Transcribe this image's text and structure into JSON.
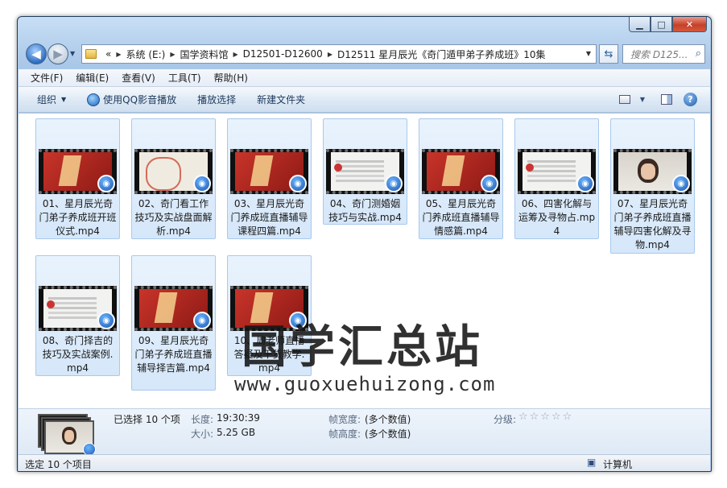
{
  "window_controls": {
    "minimize": "▁",
    "maximize": "□",
    "close": "✕"
  },
  "address": {
    "overflow": "«",
    "crumbs": [
      "系统 (E:)",
      "国学资料馆",
      "D12501-D12600",
      "D12511 星月辰光《奇门遁甲弟子养成班》10集"
    ]
  },
  "search": {
    "placeholder": "搜索 D125..."
  },
  "menu": [
    "文件(F)",
    "编辑(E)",
    "查看(V)",
    "工具(T)",
    "帮助(H)"
  ],
  "toolbar": {
    "organize": "组织",
    "qq_play": "使用QQ影音播放",
    "play_selection": "播放选择",
    "new_folder": "新建文件夹"
  },
  "files": [
    {
      "name": "01、星月辰光奇门弟子养成班开班仪式.mp4",
      "thumb": "red"
    },
    {
      "name": "02、奇门看工作技巧及实战盘面解析.mp4",
      "thumb": "scroll"
    },
    {
      "name": "03、星月辰光奇门养成班直播辅导课程四篇.mp4",
      "thumb": "red"
    },
    {
      "name": "04、奇门测婚姻技巧与实战.mp4",
      "thumb": "white"
    },
    {
      "name": "05、星月辰光奇门养成班直播辅导情感篇.mp4",
      "thumb": "red"
    },
    {
      "name": "06、四害化解与运筹及寻物占.mp4",
      "thumb": "white"
    },
    {
      "name": "07、星月辰光奇门弟子养成班直播辅导四害化解及寻物.mp4",
      "thumb": "person"
    },
    {
      "name": "08、奇门择吉的技巧及实战案例.mp4",
      "thumb": "white"
    },
    {
      "name": "09、星月辰光奇门弟子养成班直播辅导择吉篇.mp4",
      "thumb": "red"
    },
    {
      "name": "10、周老师直播答疑及干货教学.mp4",
      "thumb": "red"
    }
  ],
  "watermark": {
    "text": "国学汇总站",
    "url": "www.guoxuehuizong.com"
  },
  "details": {
    "selected": "已选择 10 个项",
    "length_label": "长度:",
    "length_value": "19:30:39",
    "size_label": "大小:",
    "size_value": "5.25 GB",
    "frame_width_label": "帧宽度:",
    "frame_width_value": "(多个数值)",
    "frame_height_label": "帧高度:",
    "frame_height_value": "(多个数值)",
    "rating_label": "分级:",
    "rating_stars": "☆☆☆☆☆",
    "rating_value": 0
  },
  "status": {
    "left": "选定 10 个项目",
    "right": "计算机"
  }
}
